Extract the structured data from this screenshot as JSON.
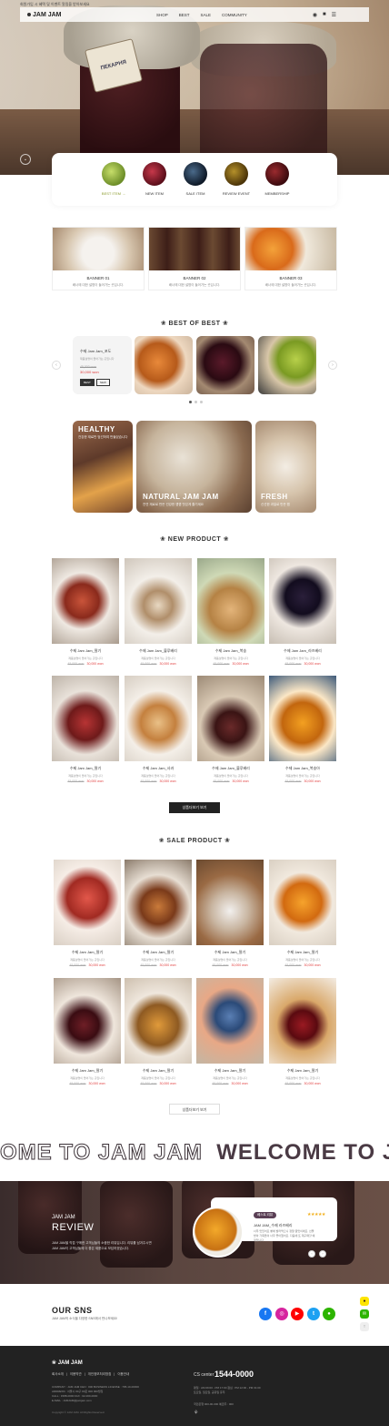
{
  "topbar": {
    "note": "회원가입 시 혜택 및 이벤트 알림을 받아보세요"
  },
  "header": {
    "logo": "JAM JAM",
    "nav": [
      "SHOP",
      "BEST",
      "SALE",
      "COMMUNITY"
    ]
  },
  "hero": {
    "tag": "ПЕКАРНЯ"
  },
  "quick_menu": [
    {
      "label": "BEST ITEM →",
      "color": "#8db642"
    },
    {
      "label": "NEW ITEM",
      "color": "#8a1a2a"
    },
    {
      "label": "SALE ITEM",
      "color": "#1d2a3a"
    },
    {
      "label": "REVIEW EVENT",
      "color": "#7a5a12"
    },
    {
      "label": "MEMBERSHIP",
      "color": "#5a1a1e"
    }
  ],
  "banners": [
    {
      "title": "BANNER 01",
      "desc": "배너에 대한 설명이 들어가는 곳입니다."
    },
    {
      "title": "BANNER 02",
      "desc": "배너에 대한 설명이 들어가는 곳입니다."
    },
    {
      "title": "BANNER 03",
      "desc": "배너에 대한 설명이 들어가는 곳입니다."
    }
  ],
  "best": {
    "title": "BEST OF BEST",
    "featured": {
      "name": "수제 Jam Jam_포도",
      "desc": "제품설명이 들어가는 곳입니다",
      "old": "45,000 won",
      "price": "30,000 won",
      "btn1": "BEST",
      "btn2": "NEW"
    },
    "categories": [
      {
        "label": "HEALTHY",
        "sub": "건강한 재료만 엄선하여 만들었습니다"
      },
      {
        "label": "NATURAL JAM JAM",
        "sub": "천연 재료로 만든 건강한 잼잼 맛있게 즐기세요"
      },
      {
        "label": "FRESH",
        "sub": "신선한 과일로 만든 잼"
      }
    ]
  },
  "new_product": {
    "title": "NEW PRODUCT",
    "items": [
      {
        "name": "수제 Jam Jam_딸기",
        "desc": "제품설명이 들어가는 곳입니다",
        "old": "45,000 won",
        "price": "30,000 won"
      },
      {
        "name": "수제 Jam Jam_블루베리",
        "desc": "제품설명이 들어가는 곳입니다",
        "old": "45,000 won",
        "price": "30,000 won"
      },
      {
        "name": "수제 Jam Jam_복숭",
        "desc": "제품설명이 들어가는 곳입니다",
        "old": "45,000 won",
        "price": "30,000 won"
      },
      {
        "name": "수제 Jam Jam_라즈베리",
        "desc": "제품설명이 들어가는 곳입니다",
        "old": "45,000 won",
        "price": "30,000 won"
      },
      {
        "name": "수제 Jam Jam_딸기",
        "desc": "제품설명이 들어가는 곳입니다",
        "old": "45,000 won",
        "price": "30,000 won"
      },
      {
        "name": "수제 Jam Jam_사과",
        "desc": "제품설명이 들어가는 곳입니다",
        "old": "45,000 won",
        "price": "30,000 won"
      },
      {
        "name": "수제 Jam Jam_블루베리",
        "desc": "제품설명이 들어가는 곳입니다",
        "old": "45,000 won",
        "price": "30,000 won"
      },
      {
        "name": "수제 Jam Jam_복숭아",
        "desc": "제품설명이 들어가는 곳입니다",
        "old": "45,000 won",
        "price": "30,000 won"
      }
    ],
    "more": "상품더보기 보기"
  },
  "sale_product": {
    "title": "SALE PRODUCT",
    "items": [
      {
        "name": "수제 Jam Jam_딸기",
        "desc": "제품설명이 들어가는 곳입니다",
        "old": "45,000 won",
        "price": "30,000 won"
      },
      {
        "name": "수제 Jam Jam_딸기",
        "desc": "제품설명이 들어가는 곳입니다",
        "old": "45,000 won",
        "price": "30,000 won"
      },
      {
        "name": "수제 Jam Jam_딸기",
        "desc": "제품설명이 들어가는 곳입니다",
        "old": "45,000 won",
        "price": "30,000 won"
      },
      {
        "name": "수제 Jam Jam_딸기",
        "desc": "제품설명이 들어가는 곳입니다",
        "old": "45,000 won",
        "price": "30,000 won"
      },
      {
        "name": "수제 Jam Jam_딸기",
        "desc": "제품설명이 들어가는 곳입니다",
        "old": "45,000 won",
        "price": "30,000 won"
      },
      {
        "name": "수제 Jam Jam_딸기",
        "desc": "제품설명이 들어가는 곳입니다",
        "old": "45,000 won",
        "price": "30,000 won"
      },
      {
        "name": "수제 Jam Jam_딸기",
        "desc": "제품설명이 들어가는 곳입니다",
        "old": "45,000 won",
        "price": "30,000 won"
      },
      {
        "name": "수제 Jam Jam_딸기",
        "desc": "제품설명이 들어가는 곳입니다",
        "old": "45,000 won",
        "price": "30,000 won"
      }
    ],
    "more": "상품더보기 보기"
  },
  "marquee": {
    "outline": "OME TO JAM JAM",
    "solid": "WELCOME TO JAM JA"
  },
  "review": {
    "kicker": "JAM JAM",
    "title": "REVIEW",
    "desc": "JAM JAM을 직접 구매한 고객님들의 소중한 리뷰입니다. 리뷰를 남겨주시면 JAM JAM이 고객님들께 더 좋은 제품으로 보답하겠습니다.",
    "badge": "베스트 리뷰",
    "stars": "★★★★★",
    "item_title": "JAM JAM_수제 라즈베리",
    "text": "너무 맛있어요 빵에 발라먹으니 정말 꿀맛이에요. 선물 받아 가족들이 너무 좋아했어요. 다음에 또 재구매할 예정입니다."
  },
  "sns": {
    "title": "OUR SNS",
    "desc": "JAM JAM의 소식을 다양한 SNS에서 만나보세요!",
    "icons": [
      {
        "name": "facebook",
        "glyph": "f",
        "color": "#1877f2"
      },
      {
        "name": "instagram",
        "glyph": "◎",
        "color": "#d6249f"
      },
      {
        "name": "youtube",
        "glyph": "▶",
        "color": "#ff0000"
      },
      {
        "name": "twitter",
        "glyph": "t",
        "color": "#1da1f2"
      },
      {
        "name": "talk",
        "glyph": "●",
        "color": "#2db400"
      }
    ]
  },
  "footer": {
    "logo": "JAM JAM",
    "links": [
      "회사소개",
      "|",
      "이용약관",
      "|",
      "개인정보처리방침",
      "|",
      "이용안내"
    ],
    "info": "COMPANY : JAM JAM  CEO : 000  BUSINESS LICENSE : 795-10-00000\nADDRESS : 서울시 00구 00로 000 000빌딩\nCALL : 1588-0000  FAX : 02-000-0000\nE-MAIL : JAMJAM@jamjam.com",
    "copyright": "Copyright © JAM JAM. All Rights Reserved.",
    "cs_label": "CS center",
    "cs_number": "1544-0000",
    "cs_hours": "평일 : AM 09:00 - PM 17:00  점심 : PM 12:00 - PM 01:00\n토요일, 일요일, 공휴일 휴무",
    "bank": "국민은행 000-00-000 예금주 : 000",
    "channel": "⚘"
  }
}
